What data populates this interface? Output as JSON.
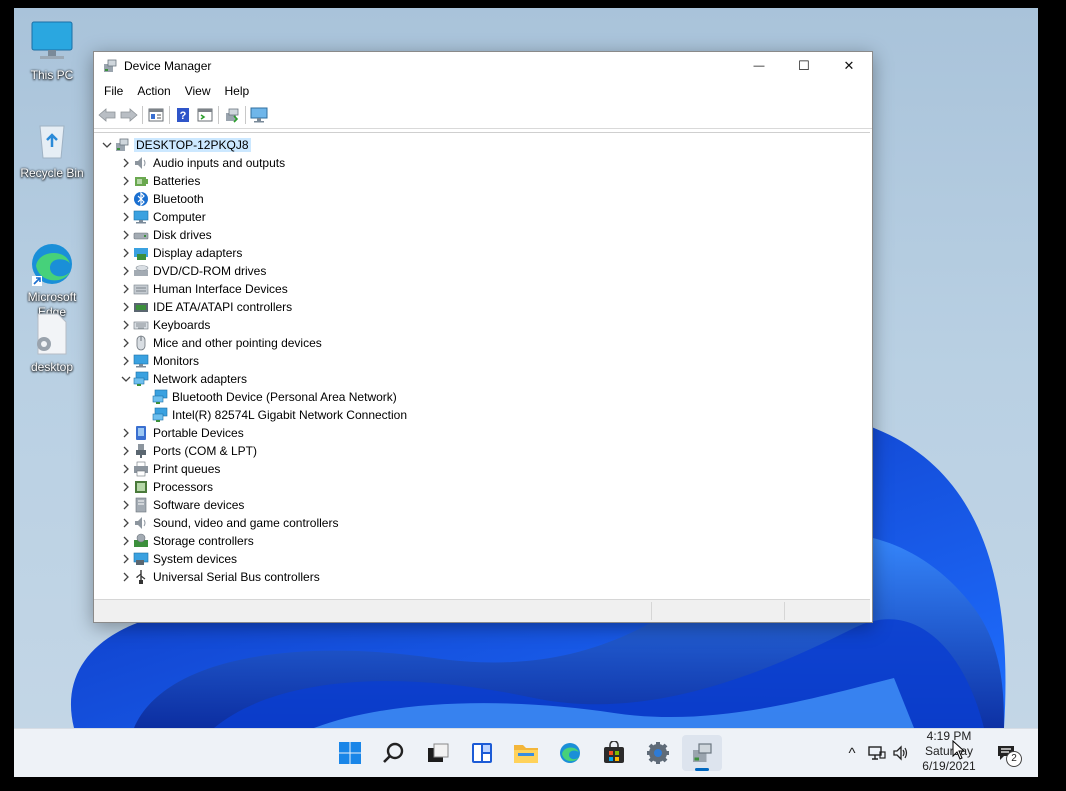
{
  "desktop": {
    "icons": [
      {
        "label": "This PC",
        "icon": "this-pc-icon"
      },
      {
        "label": "Recycle Bin",
        "icon": "recycle-bin-icon"
      },
      {
        "label": "Microsoft\nEdge",
        "icon": "edge-icon"
      },
      {
        "label": "desktop",
        "icon": "settings-file-icon"
      }
    ]
  },
  "window": {
    "title": "Device Manager",
    "controls": {
      "minimize": "—",
      "maximize": "☐",
      "close": "✕"
    },
    "menu": [
      "File",
      "Action",
      "View",
      "Help"
    ],
    "toolbar": [
      "back-icon",
      "forward-icon",
      "properties-icon",
      "help-icon",
      "update-driver-icon",
      "scan-hardware-icon",
      "monitor-icon"
    ],
    "root": "DESKTOP-12PKQJ8",
    "categories": [
      {
        "label": "Audio inputs and outputs",
        "icon": "speaker-icon"
      },
      {
        "label": "Batteries",
        "icon": "battery-icon"
      },
      {
        "label": "Bluetooth",
        "icon": "bluetooth-icon"
      },
      {
        "label": "Computer",
        "icon": "computer-icon"
      },
      {
        "label": "Disk drives",
        "icon": "disk-drive-icon"
      },
      {
        "label": "Display adapters",
        "icon": "display-adapter-icon"
      },
      {
        "label": "DVD/CD-ROM drives",
        "icon": "dvd-drive-icon"
      },
      {
        "label": "Human Interface Devices",
        "icon": "hid-icon"
      },
      {
        "label": "IDE ATA/ATAPI controllers",
        "icon": "ide-controller-icon"
      },
      {
        "label": "Keyboards",
        "icon": "keyboard-icon"
      },
      {
        "label": "Mice and other pointing devices",
        "icon": "mouse-icon"
      },
      {
        "label": "Monitors",
        "icon": "monitor-icon"
      },
      {
        "label": "Network adapters",
        "icon": "network-adapter-icon",
        "expanded": true,
        "children": [
          "Bluetooth Device (Personal Area Network)",
          "Intel(R) 82574L Gigabit Network Connection"
        ]
      },
      {
        "label": "Portable Devices",
        "icon": "portable-device-icon"
      },
      {
        "label": "Ports (COM & LPT)",
        "icon": "port-icon"
      },
      {
        "label": "Print queues",
        "icon": "printer-icon"
      },
      {
        "label": "Processors",
        "icon": "processor-icon"
      },
      {
        "label": "Software devices",
        "icon": "software-device-icon"
      },
      {
        "label": "Sound, video and game controllers",
        "icon": "sound-icon"
      },
      {
        "label": "Storage controllers",
        "icon": "storage-controller-icon"
      },
      {
        "label": "System devices",
        "icon": "system-device-icon"
      },
      {
        "label": "Universal Serial Bus controllers",
        "icon": "usb-icon"
      }
    ]
  },
  "taskbar": {
    "apps": [
      "start-icon",
      "search-icon",
      "task-view-icon",
      "widgets-icon",
      "file-explorer-icon",
      "edge-icon",
      "store-icon",
      "settings-icon",
      "device-manager-icon"
    ],
    "tray": {
      "chevron": "^",
      "time": "4:19 PM",
      "day": "Saturday",
      "date": "6/19/2021",
      "notifications": "2"
    }
  },
  "colors": {
    "accent": "#0067c0",
    "selection": "#cce8ff"
  }
}
